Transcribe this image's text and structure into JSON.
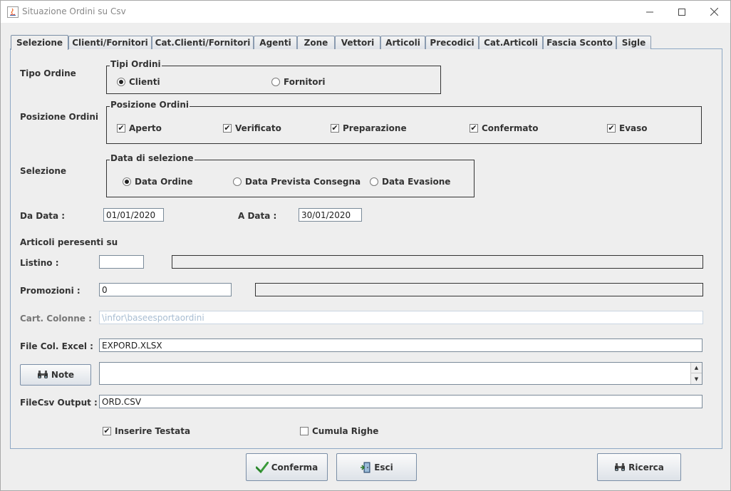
{
  "window": {
    "title": "Situazione Ordini su Csv"
  },
  "tabs": [
    {
      "label": "Selezione",
      "active": true
    },
    {
      "label": "Clienti/Fornitori"
    },
    {
      "label": "Cat.Clienti/Fornitori"
    },
    {
      "label": "Agenti"
    },
    {
      "label": "Zone"
    },
    {
      "label": "Vettori"
    },
    {
      "label": "Articoli"
    },
    {
      "label": "Precodici"
    },
    {
      "label": "Cat.Articoli"
    },
    {
      "label": "Fascia Sconto"
    },
    {
      "label": "Sigle"
    }
  ],
  "tipo_ordine": {
    "label": "Tipo Ordine",
    "group_title": "Tipi Ordini",
    "options": [
      "Clienti",
      "Fornitori"
    ],
    "selected": "Clienti"
  },
  "posizione_ordini": {
    "label": "Posizione Ordini",
    "group_title": "Posizione Ordini",
    "options": [
      "Aperto",
      "Verificato",
      "Preparazione",
      "Confermato",
      "Evaso"
    ],
    "checked": [
      true,
      true,
      true,
      true,
      true
    ]
  },
  "selezione": {
    "label": "Selezione",
    "group_title": "Data di selezione",
    "options": [
      "Data Ordine",
      "Data Prevista Consegna",
      "Data Evasione"
    ],
    "selected": "Data Ordine"
  },
  "dates": {
    "da_label": "Da Data  :",
    "da_value": "01/01/2020",
    "a_label": "A   Data :",
    "a_value": "30/01/2020"
  },
  "articoli_label": "Articoli peresenti su",
  "listino": {
    "label": "Listino :",
    "value": "",
    "description": ""
  },
  "promozioni": {
    "label": "Promozioni :",
    "value": "0",
    "description": ""
  },
  "cart_colonne": {
    "label": "Cart. Colonne :",
    "value": "\\infor\\baseesportaordini"
  },
  "file_col_excel": {
    "label": "File Col. Excel :",
    "value": "EXPORD.XLSX"
  },
  "note": {
    "button_label": "Note",
    "value": ""
  },
  "filecsv_output": {
    "label": "FileCsv Output :",
    "value": "ORD.CSV"
  },
  "options": {
    "inserire_testata": {
      "label": "Inserire Testata",
      "checked": true
    },
    "cumula_righe": {
      "label": "Cumula Righe",
      "checked": false
    }
  },
  "buttons": {
    "conferma": "Conferma",
    "esci": "Esci",
    "ricerca": "Ricerca"
  },
  "icons": {
    "app": "java-icon",
    "note": "binoculars-icon",
    "conferma": "checkmark-icon",
    "esci": "exit-door-icon",
    "ricerca": "binoculars-icon"
  },
  "colors": {
    "tab_border": "#8a9bb0",
    "panel_border": "#8ea8c4",
    "disabled_text": "#a8bdd2"
  }
}
